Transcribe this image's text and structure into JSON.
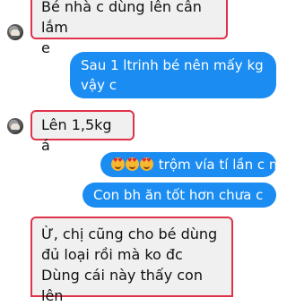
{
  "messages": [
    {
      "side": "in",
      "text_lines": [
        "Bé nhà c dùng lên cân lắm",
        "e"
      ]
    },
    {
      "side": "out",
      "text_lines": [
        "Sau 1 ltrinh bé nên mấy kg",
        "vậy c"
      ]
    },
    {
      "side": "in",
      "text_lines": [
        "Lên 1,5kg á"
      ]
    },
    {
      "side": "out",
      "emoji": [
        "smiling-face-with-heart-eyes",
        "smiling-face-with-heart-eyes",
        "smiling-face-with-heart-eyes"
      ],
      "text_lines": [
        "trộm vía tí lần c nhỉ."
      ]
    },
    {
      "side": "out",
      "text_lines": [
        "Con bh ăn tốt hơn chưa c"
      ]
    },
    {
      "side": "in",
      "text_lines": [
        "Ừ, chị cũng cho bé dùng",
        "đủ loại rồi mà ko đc",
        "Dùng cái này thấy con lên"
      ]
    }
  ],
  "colors": {
    "incoming_bubble": "#f1f0f0",
    "outgoing_bubble": "#1a8cf2",
    "highlight_border": "#e0334a"
  }
}
